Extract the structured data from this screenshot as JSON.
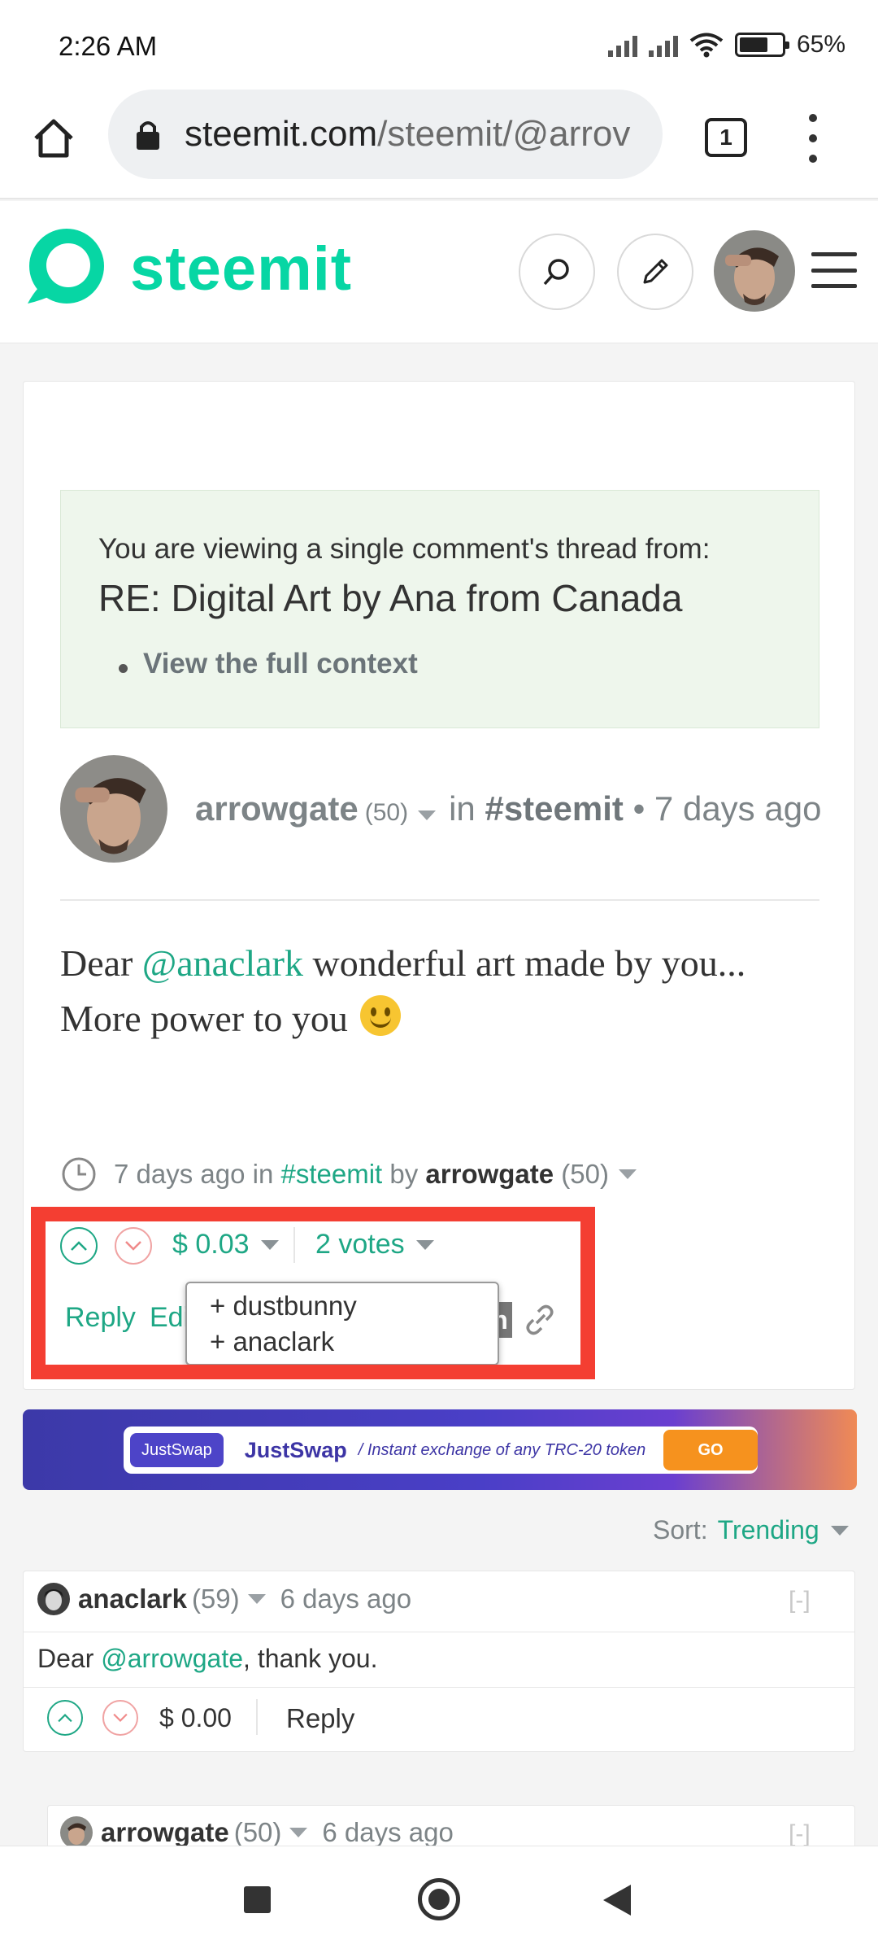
{
  "status_bar": {
    "time": "2:26 AM",
    "battery": "65%"
  },
  "browser": {
    "url_main": "steemit.com",
    "url_path": "/steemit/@arrov",
    "tab_count": "1"
  },
  "site": {
    "logo_text": "steemit",
    "brand_color": "#07d6a4",
    "accent_color": "#1ea785"
  },
  "thread_notice": {
    "intro": "You are viewing a single comment's thread from:",
    "title": "RE: Digital Art by Ana from Canada",
    "context_link": "View the full context"
  },
  "post": {
    "author": "arrowgate",
    "reputation": "(50)",
    "in_label": "in",
    "tag": "#steemit",
    "age": "• 7 days ago",
    "body_prefix": "Dear ",
    "body_mention": "@anaclark",
    "body_rest": " wonderful art made by you... More power to you",
    "meta_age": "7 days ago in",
    "meta_tag": "#steemit",
    "meta_by": "by",
    "meta_author": "arrowgate",
    "meta_rep": "(50)",
    "payout": "$ 0.03",
    "votes": "2 votes",
    "reply_label": "Reply",
    "edit_label": "Edit",
    "share_glyph": "n",
    "voters": [
      "+ dustbunny",
      "+ anaclark"
    ]
  },
  "ad": {
    "chip": "JustSwap",
    "brand": "JustSwap",
    "tagline": "/ Instant exchange of any TRC-20 token",
    "go": "GO"
  },
  "sort": {
    "label": "Sort:",
    "value": "Trending"
  },
  "comments": [
    {
      "author": "anaclark",
      "reputation": "(59)",
      "age": "6 days ago",
      "collapse": "[-]",
      "body_prefix": "Dear ",
      "body_mention": "@arrowgate",
      "body_rest": ", thank you.",
      "payout": "$ 0.00",
      "reply_label": "Reply"
    },
    {
      "author": "arrowgate",
      "reputation": "(50)",
      "age": "6 days ago",
      "collapse": "[-]"
    }
  ]
}
